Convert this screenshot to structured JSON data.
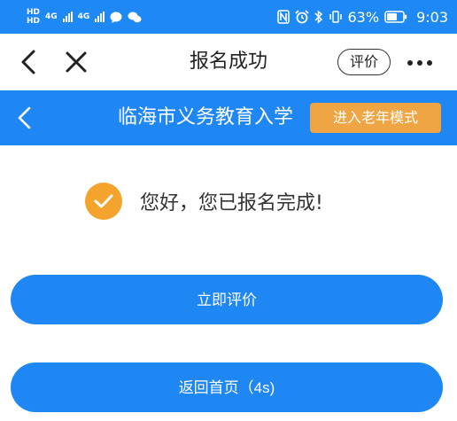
{
  "status_bar": {
    "hd1": "HD",
    "hd2": "HD",
    "net1": "4G",
    "net2": "4G",
    "battery": "63%",
    "time": "9:03",
    "icons": [
      "nfc-icon",
      "alarm-icon",
      "bluetooth-icon",
      "vibrate-icon",
      "battery-icon",
      "chat-bubble-icon",
      "wechat-icon"
    ]
  },
  "nav": {
    "title": "报名成功",
    "rate_label": "评价"
  },
  "page_header": {
    "title": "临海市义务教育入学",
    "elder_mode_label": "进入老年模式"
  },
  "result": {
    "message": "您好，您已报名完成!"
  },
  "actions": {
    "rate_now": "立即评价",
    "back_home": "返回首页（4s)"
  },
  "colors": {
    "primary": "#1f87f3",
    "accent": "#f0a544",
    "check": "#f4a32c"
  }
}
